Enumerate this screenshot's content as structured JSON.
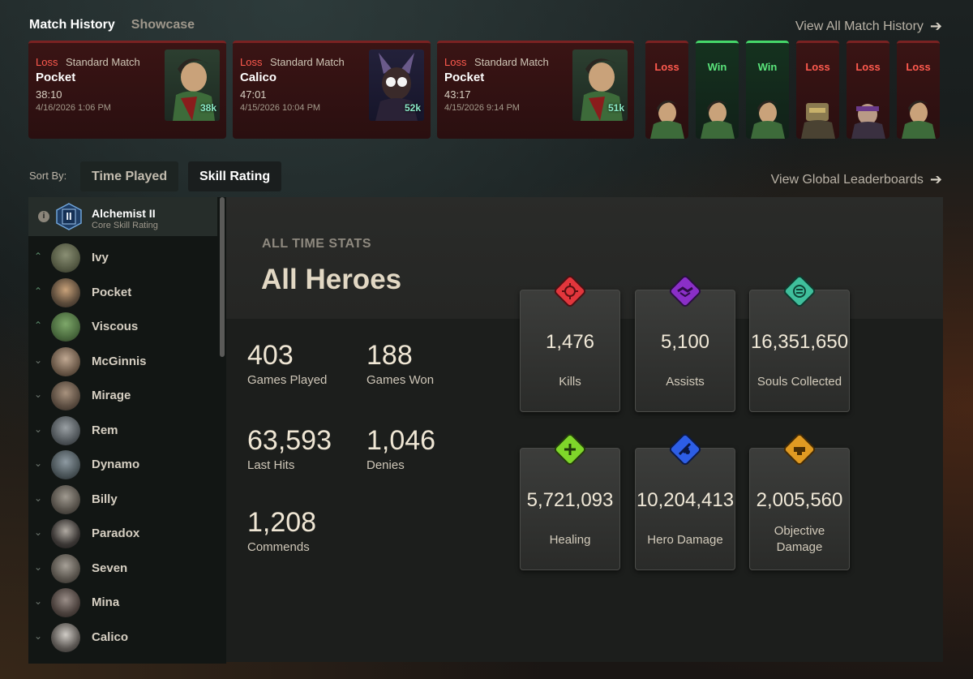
{
  "tabs": {
    "history": "Match History",
    "showcase": "Showcase"
  },
  "view_all": "View All Match History",
  "matches": [
    {
      "result": "Loss",
      "mode": "Standard Match",
      "hero": "Pocket",
      "duration": "38:10",
      "date": "4/16/2026 1:06 PM",
      "souls": "38k"
    },
    {
      "result": "Loss",
      "mode": "Standard Match",
      "hero": "Calico",
      "duration": "47:01",
      "date": "4/15/2026 10:04 PM",
      "souls": "52k"
    },
    {
      "result": "Loss",
      "mode": "Standard Match",
      "hero": "Pocket",
      "duration": "43:17",
      "date": "4/15/2026 9:14 PM",
      "souls": "51k"
    }
  ],
  "mini_matches": [
    {
      "result": "Loss"
    },
    {
      "result": "Win"
    },
    {
      "result": "Win"
    },
    {
      "result": "Loss"
    },
    {
      "result": "Loss"
    },
    {
      "result": "Loss"
    }
  ],
  "sort": {
    "label": "Sort By:",
    "time_played": "Time Played",
    "skill_rating": "Skill Rating"
  },
  "view_leaderboards": "View Global Leaderboards",
  "rank": {
    "name": "Alchemist II",
    "sub": "Core Skill Rating",
    "numeral": "II",
    "info": "i"
  },
  "heroes": [
    {
      "name": "Ivy",
      "trend": "up"
    },
    {
      "name": "Pocket",
      "trend": "up"
    },
    {
      "name": "Viscous",
      "trend": "up"
    },
    {
      "name": "McGinnis",
      "trend": "down"
    },
    {
      "name": "Mirage",
      "trend": "down"
    },
    {
      "name": "Rem",
      "trend": "down"
    },
    {
      "name": "Dynamo",
      "trend": "down"
    },
    {
      "name": "Billy",
      "trend": "down"
    },
    {
      "name": "Paradox",
      "trend": "down"
    },
    {
      "name": "Seven",
      "trend": "down"
    },
    {
      "name": "Mina",
      "trend": "down"
    },
    {
      "name": "Calico",
      "trend": "down"
    }
  ],
  "stats": {
    "kicker": "ALL TIME STATS",
    "title": "All Heroes",
    "games_played": {
      "value": "403",
      "label": "Games Played"
    },
    "games_won": {
      "value": "188",
      "label": "Games Won"
    },
    "last_hits": {
      "value": "63,593",
      "label": "Last Hits"
    },
    "denies": {
      "value": "1,046",
      "label": "Denies"
    },
    "commends": {
      "value": "1,208",
      "label": "Commends"
    }
  },
  "tiles": {
    "kills": {
      "value": "1,476",
      "label": "Kills",
      "color": "#e2363c",
      "icon": "crosshair-icon"
    },
    "assists": {
      "value": "5,100",
      "label": "Assists",
      "color": "#8a2fc7",
      "icon": "handshake-icon"
    },
    "souls": {
      "value": "16,351,650",
      "label": "Souls Collected",
      "color": "#3fbf9c",
      "icon": "soul-icon"
    },
    "healing": {
      "value": "5,721,093",
      "label": "Healing",
      "color": "#7fd62a",
      "icon": "plus-icon"
    },
    "hero_damage": {
      "value": "10,204,413",
      "label": "Hero Damage",
      "color": "#2d5ee6",
      "icon": "damage-icon"
    },
    "objective_damage": {
      "value": "2,005,560",
      "label": "Objective Damage",
      "color": "#e09a22",
      "icon": "objective-icon"
    }
  },
  "colors": {
    "loss": "#ff5a4e",
    "win": "#5be57c",
    "souls": "#8ae8c6"
  }
}
